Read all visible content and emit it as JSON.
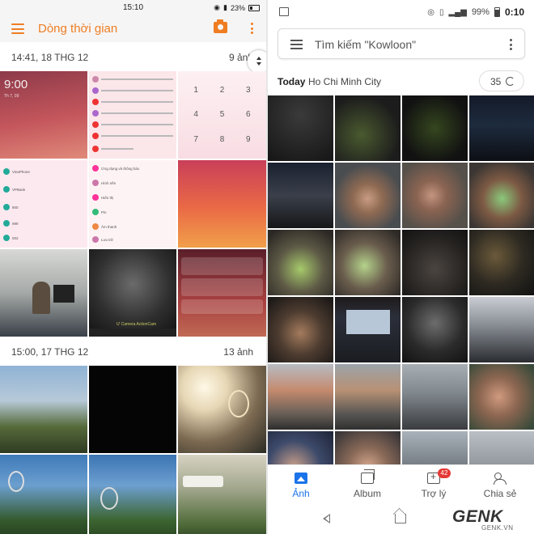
{
  "left": {
    "status": {
      "time": "15:10",
      "battery": "23%"
    },
    "app_title": "Dòng thời gian",
    "sections": [
      {
        "date": "14:41, 18 THG 12",
        "count": "9 ảnh"
      },
      {
        "date": "15:00, 17 THG 12",
        "count": "13 ảnh"
      }
    ],
    "lockscreen_time": "9:00",
    "lockscreen_date": "Th 7, 09",
    "keypad_digits": [
      "1",
      "2",
      "3",
      "4",
      "5",
      "6",
      "7",
      "8",
      "9"
    ],
    "keypad_sub": [
      "GHI",
      "JKL",
      "MNO",
      "PQRS",
      "TUV",
      "WXYZ"
    ],
    "contacts": [
      "VinaPhone",
      "VPBank",
      "900",
      "999",
      "002"
    ],
    "settings_items": [
      "Ứng dụng và thông báo",
      "Hình nền",
      "Hiển thị",
      "Pin",
      "Âm thanh",
      "Lưu trữ"
    ],
    "photo_caption": "Ứ Camera ActionCam"
  },
  "right": {
    "status": {
      "battery_pct": "99%",
      "time": "0:10"
    },
    "search_placeholder": "Tìm kiếm \"Kowloon\"",
    "today_label": "Today",
    "location": "Ho Chi Minh City",
    "count": "35",
    "nav": [
      {
        "label": "Ảnh"
      },
      {
        "label": "Album"
      },
      {
        "label": "Trợ lý",
        "badge": "42"
      },
      {
        "label": "Chia sẻ"
      }
    ],
    "watermark": {
      "logo": "GENK",
      "domain": "GENK.VN"
    }
  },
  "colors": {
    "accent_orange": "#ef7d22",
    "accent_blue": "#1a73e8",
    "badge_red": "#e53935"
  },
  "icons": [
    "hamburger-icon",
    "camera-icon",
    "more-vertical-icon",
    "scroll-handle-icon",
    "image-icon",
    "menu-icon",
    "sync-icon",
    "photo-icon",
    "album-icon",
    "assistant-icon",
    "share-icon",
    "back-icon",
    "home-icon"
  ]
}
